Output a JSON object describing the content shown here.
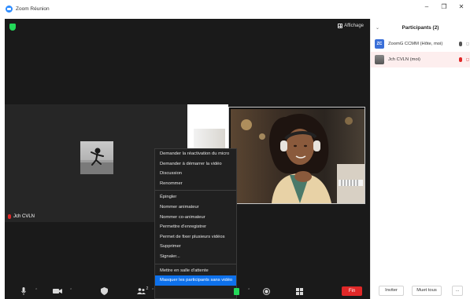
{
  "window": {
    "title": "Zoom Réunion",
    "controls": [
      "–",
      "❐",
      "✕"
    ]
  },
  "meeting": {
    "view_label": "Affichage",
    "self_name": "Jch CVLN"
  },
  "context_menu": {
    "items": [
      "Demander la réactivation du micro",
      "Demander à démarrer la vidéo",
      "Discussion",
      "Renommer",
      "Épingler",
      "Nommer animateur",
      "Nommer co-animateur",
      "Permettre d'enregistrer",
      "Permet de fixer plusieurs vidéos",
      "Supprimer",
      "Signaler...",
      "Mettre en salle d'attente",
      "Masquer les participants sans vidéo"
    ],
    "highlighted": "Masquer les participants sans vidéo"
  },
  "toolbar": {
    "participants_count": "2",
    "end_label": "Fin"
  },
  "participants": {
    "title": "Participants (2)",
    "list": [
      {
        "initials": "ZC",
        "name": "ZoomG CCMM (Hôte, moi)"
      },
      {
        "initials": "",
        "name": "Jch CVLN (moi)"
      }
    ],
    "footer": {
      "invite_label": "Inviter",
      "mute_all_label": "Muet tous",
      "more_label": "..."
    }
  },
  "colors": {
    "accent": "#0e71eb",
    "end": "#e02828",
    "secure": "#23d959"
  }
}
